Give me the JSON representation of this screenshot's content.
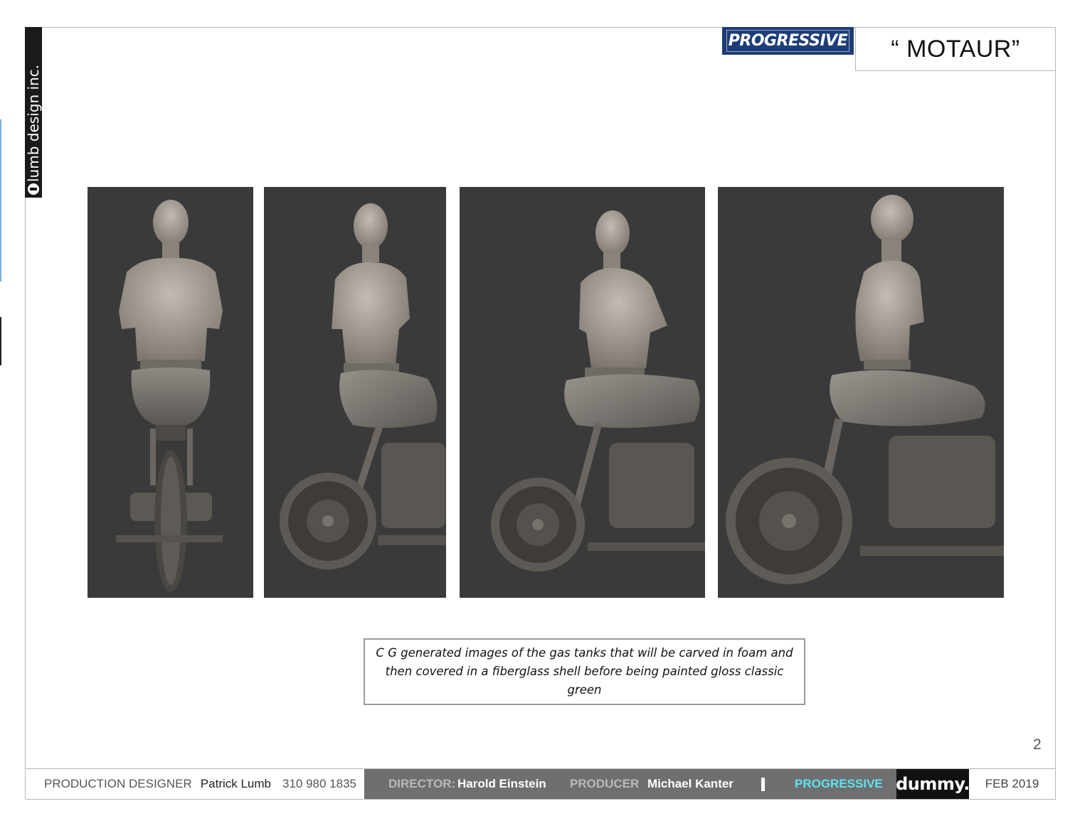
{
  "brand": {
    "name": "lumb design inc."
  },
  "client_logo": {
    "text": "PROGRESSIVE"
  },
  "title": "“ MOTAUR”",
  "panels": [
    {
      "view": "front view",
      "image": "motaur-render-front"
    },
    {
      "view": "three-quarter view",
      "image": "motaur-render-three-quarter"
    },
    {
      "view": "oblique side view",
      "image": "motaur-render-oblique"
    },
    {
      "view": "side view",
      "image": "motaur-render-side"
    }
  ],
  "caption": "C G generated images of the gas tanks that will be carved in foam and then covered in a fiberglass shell before being painted gloss classic green",
  "page_number": "2",
  "footer": {
    "production_designer_label": "PRODUCTION DESIGNER",
    "production_designer_name": "Patrick Lumb",
    "phone": "310 980 1835",
    "director_label": "DIRECTOR:",
    "director_name": "Harold Einstein",
    "producer_label": "PRODUCER",
    "producer_name": "Michael Kanter",
    "client": "PROGRESSIVE",
    "company": "dummy.",
    "date": "FEB 2019"
  },
  "colors": {
    "progressive_blue": "#1c3d78",
    "footer_gray": "#6f6f6f",
    "client_cyan": "#5ee3f0",
    "panel_background": "#3a3a3a"
  }
}
